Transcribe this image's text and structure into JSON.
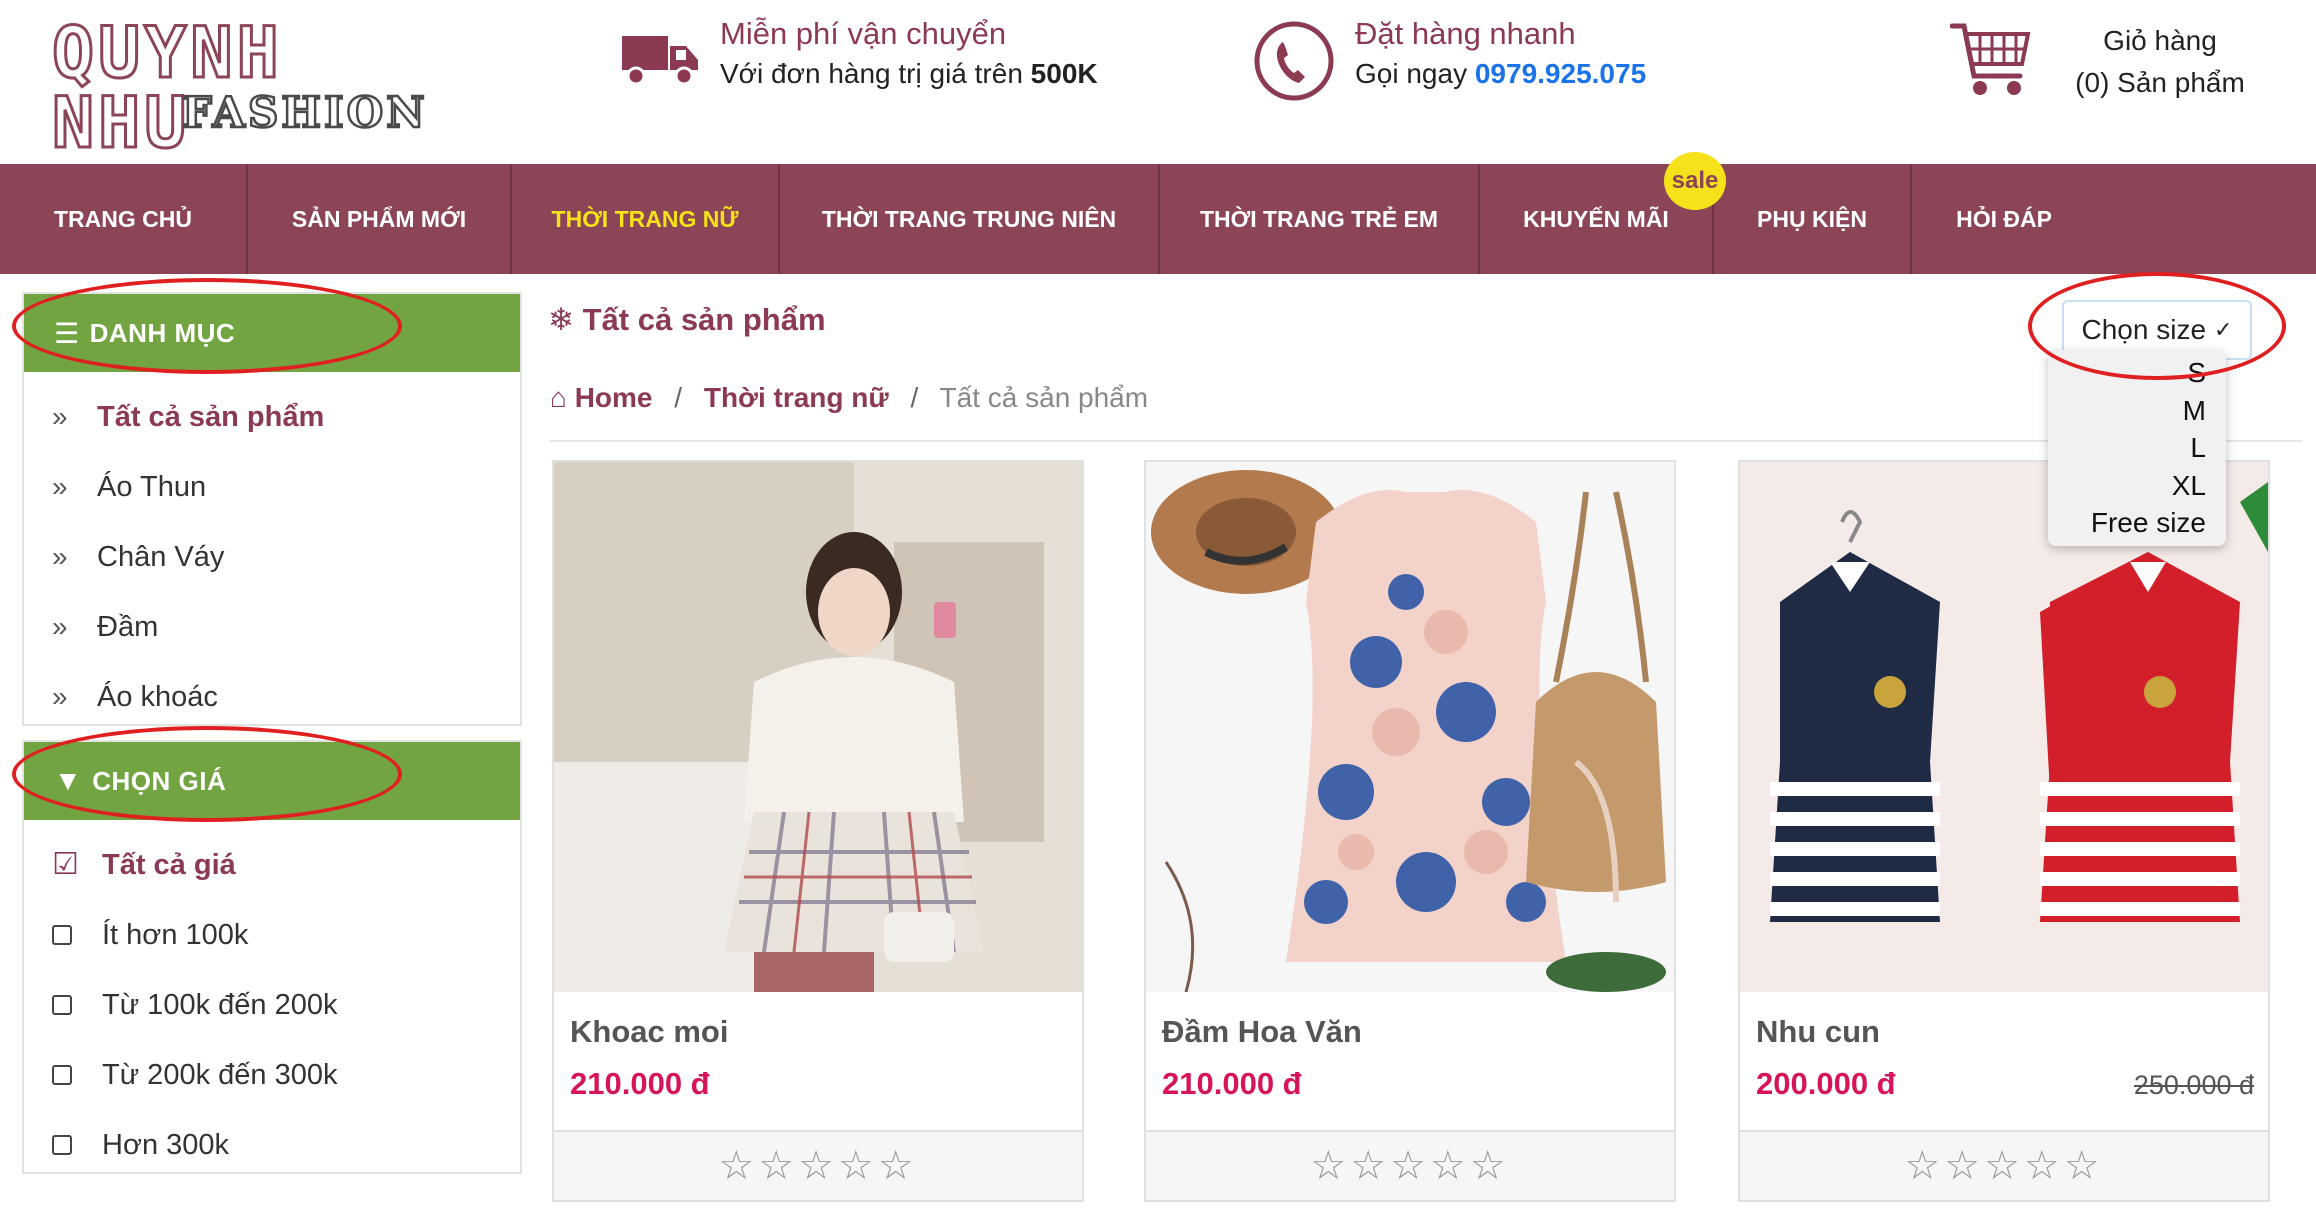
{
  "header": {
    "logo_line1": "QUYNH NHU",
    "logo_line2": "FASHION",
    "shipping_title": "Miễn phí vận chuyển",
    "shipping_sub": "Với đơn hàng trị giá trên",
    "shipping_amount": "500K",
    "order_title": "Đặt hàng nhanh",
    "order_sub": "Gọi ngay",
    "order_phone": "0979.925.075",
    "cart_title": "Giỏ hàng",
    "cart_count": "(0) Sản phẩm"
  },
  "nav": {
    "items": [
      "TRANG CHỦ",
      "SẢN PHẨM MỚI",
      "THỜI TRANG NỮ",
      "THỜI TRANG TRUNG NIÊN",
      "THỜI TRANG TRẺ EM",
      "KHUYẾN MÃI",
      "PHỤ KIỆN",
      "HỎI ĐÁP"
    ],
    "active": "THỜI TRANG NỮ",
    "sale_badge": "sale"
  },
  "sidebar": {
    "category_title": "DANH MỤC",
    "categories": [
      "Tất cả sản phẩm",
      "Áo Thun",
      "Chân Váy",
      "Đầm",
      "Áo khoác"
    ],
    "price_title": "CHỌN GIÁ",
    "prices": [
      "Tất cả giá",
      "Ít hơn 100k",
      "Từ 100k đến 200k",
      "Từ 200k đến 300k",
      "Hơn 300k"
    ]
  },
  "main": {
    "title": "Tất cả sản phẩm",
    "breadcrumb": {
      "home": "Home",
      "category": "Thời trang nữ",
      "current": "Tất cả sản phẩm",
      "sep": "/"
    },
    "size_select": {
      "label": "Chọn size",
      "options": [
        "S",
        "M",
        "L",
        "XL",
        "Free size"
      ]
    }
  },
  "products": [
    {
      "name": "Khoac moi",
      "price": "210.000 đ",
      "old_price": "",
      "stars": "☆☆☆☆☆"
    },
    {
      "name": "Đầm Hoa Văn",
      "price": "210.000 đ",
      "old_price": "",
      "stars": "☆☆☆☆☆"
    },
    {
      "name": "Nhu cun",
      "price": "200.000 đ",
      "old_price": "250.000 đ",
      "stars": "☆☆☆☆☆"
    }
  ],
  "colors": {
    "brand": "#8b4557",
    "accent": "#72a442",
    "sale": "#f5e21a",
    "price": "#d7145a",
    "highlight": "#e02020"
  }
}
